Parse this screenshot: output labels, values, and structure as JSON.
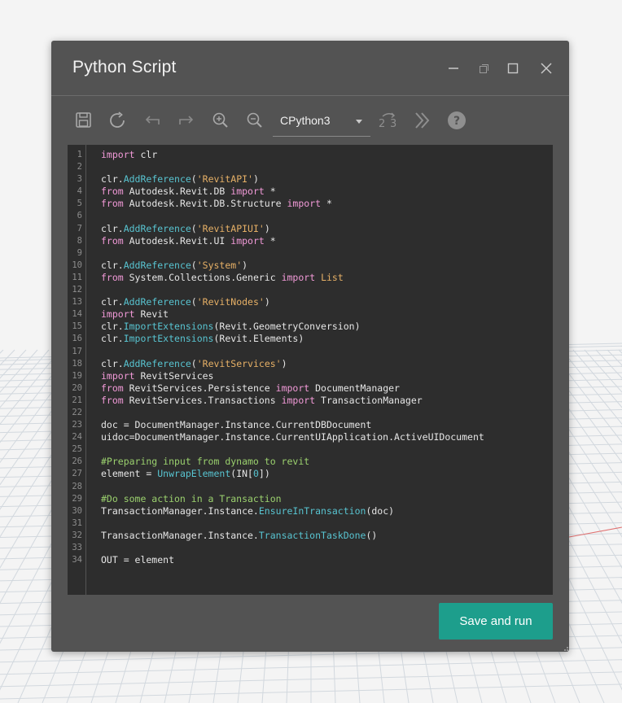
{
  "window": {
    "title": "Python Script",
    "controls": [
      "minimize-icon",
      "restore-icon",
      "maximize-icon",
      "close-icon"
    ]
  },
  "toolbar": {
    "tools": [
      "save-icon",
      "refresh-icon",
      "undo-icon",
      "redo-icon",
      "zoom-in-icon",
      "zoom-out-icon"
    ],
    "engine": {
      "selected": "CPython3"
    },
    "extra_tools": [
      "migrate-2to3-icon",
      "more-chevron-icon",
      "help-icon"
    ]
  },
  "editor": {
    "lines": [
      [
        [
          "kw",
          "import"
        ],
        [
          "t",
          " clr"
        ]
      ],
      [],
      [
        [
          "t",
          "clr."
        ],
        [
          "fn",
          "AddReference"
        ],
        [
          "t",
          "("
        ],
        [
          "str",
          "'RevitAPI'"
        ],
        [
          "t",
          ")"
        ]
      ],
      [
        [
          "kw",
          "from"
        ],
        [
          "t",
          " Autodesk.Revit.DB "
        ],
        [
          "kw",
          "import"
        ],
        [
          "t",
          " *"
        ]
      ],
      [
        [
          "kw",
          "from"
        ],
        [
          "t",
          " Autodesk.Revit.DB.Structure "
        ],
        [
          "kw",
          "import"
        ],
        [
          "t",
          " *"
        ]
      ],
      [],
      [
        [
          "t",
          "clr."
        ],
        [
          "fn",
          "AddReference"
        ],
        [
          "t",
          "("
        ],
        [
          "str",
          "'RevitAPIUI'"
        ],
        [
          "t",
          ")"
        ]
      ],
      [
        [
          "kw",
          "from"
        ],
        [
          "t",
          " Autodesk.Revit.UI "
        ],
        [
          "kw",
          "import"
        ],
        [
          "t",
          " *"
        ]
      ],
      [],
      [
        [
          "t",
          "clr."
        ],
        [
          "fn",
          "AddReference"
        ],
        [
          "t",
          "("
        ],
        [
          "str",
          "'System'"
        ],
        [
          "t",
          ")"
        ]
      ],
      [
        [
          "kw",
          "from"
        ],
        [
          "t",
          " System.Collections.Generic "
        ],
        [
          "kw",
          "import"
        ],
        [
          "t",
          " "
        ],
        [
          "str",
          "List"
        ]
      ],
      [],
      [
        [
          "t",
          "clr."
        ],
        [
          "fn",
          "AddReference"
        ],
        [
          "t",
          "("
        ],
        [
          "str",
          "'RevitNodes'"
        ],
        [
          "t",
          ")"
        ]
      ],
      [
        [
          "kw",
          "import"
        ],
        [
          "t",
          " Revit"
        ]
      ],
      [
        [
          "t",
          "clr."
        ],
        [
          "fn",
          "ImportExtensions"
        ],
        [
          "t",
          "(Revit.GeometryConversion)"
        ]
      ],
      [
        [
          "t",
          "clr."
        ],
        [
          "fn",
          "ImportExtensions"
        ],
        [
          "t",
          "(Revit.Elements)"
        ]
      ],
      [],
      [
        [
          "t",
          "clr."
        ],
        [
          "fn",
          "AddReference"
        ],
        [
          "t",
          "("
        ],
        [
          "str",
          "'RevitServices'"
        ],
        [
          "t",
          ")"
        ]
      ],
      [
        [
          "kw",
          "import"
        ],
        [
          "t",
          " RevitServices"
        ]
      ],
      [
        [
          "kw",
          "from"
        ],
        [
          "t",
          " RevitServices.Persistence "
        ],
        [
          "kw",
          "import"
        ],
        [
          "t",
          " DocumentManager"
        ]
      ],
      [
        [
          "kw",
          "from"
        ],
        [
          "t",
          " RevitServices.Transactions "
        ],
        [
          "kw",
          "import"
        ],
        [
          "t",
          " TransactionManager"
        ]
      ],
      [],
      [
        [
          "t",
          "doc = DocumentManager.Instance.CurrentDBDocument"
        ]
      ],
      [
        [
          "t",
          "uidoc=DocumentManager.Instance.CurrentUIApplication.ActiveUIDocument"
        ]
      ],
      [],
      [
        [
          "cmt",
          "#Preparing input from dynamo to revit"
        ]
      ],
      [
        [
          "t",
          "element = "
        ],
        [
          "fn",
          "UnwrapElement"
        ],
        [
          "t",
          "(IN["
        ],
        [
          "num",
          "0"
        ],
        [
          "t",
          "])"
        ]
      ],
      [],
      [
        [
          "cmt",
          "#Do some action in a Transaction"
        ]
      ],
      [
        [
          "t",
          "TransactionManager.Instance."
        ],
        [
          "fn",
          "EnsureInTransaction"
        ],
        [
          "t",
          "(doc)"
        ]
      ],
      [],
      [
        [
          "t",
          "TransactionManager.Instance."
        ],
        [
          "fn",
          "TransactionTaskDone"
        ],
        [
          "t",
          "()"
        ]
      ],
      [],
      [
        [
          "t",
          "OUT = element"
        ]
      ]
    ]
  },
  "actions": {
    "save_run_label": "Save and run"
  },
  "colors": {
    "accent": "#1d9e8c",
    "dialog": "#535353",
    "editor_bg": "#2d2d2d",
    "keyword": "#f29ad8",
    "function": "#58c4d1",
    "string": "#e6b066",
    "comment": "#9bd16e"
  }
}
